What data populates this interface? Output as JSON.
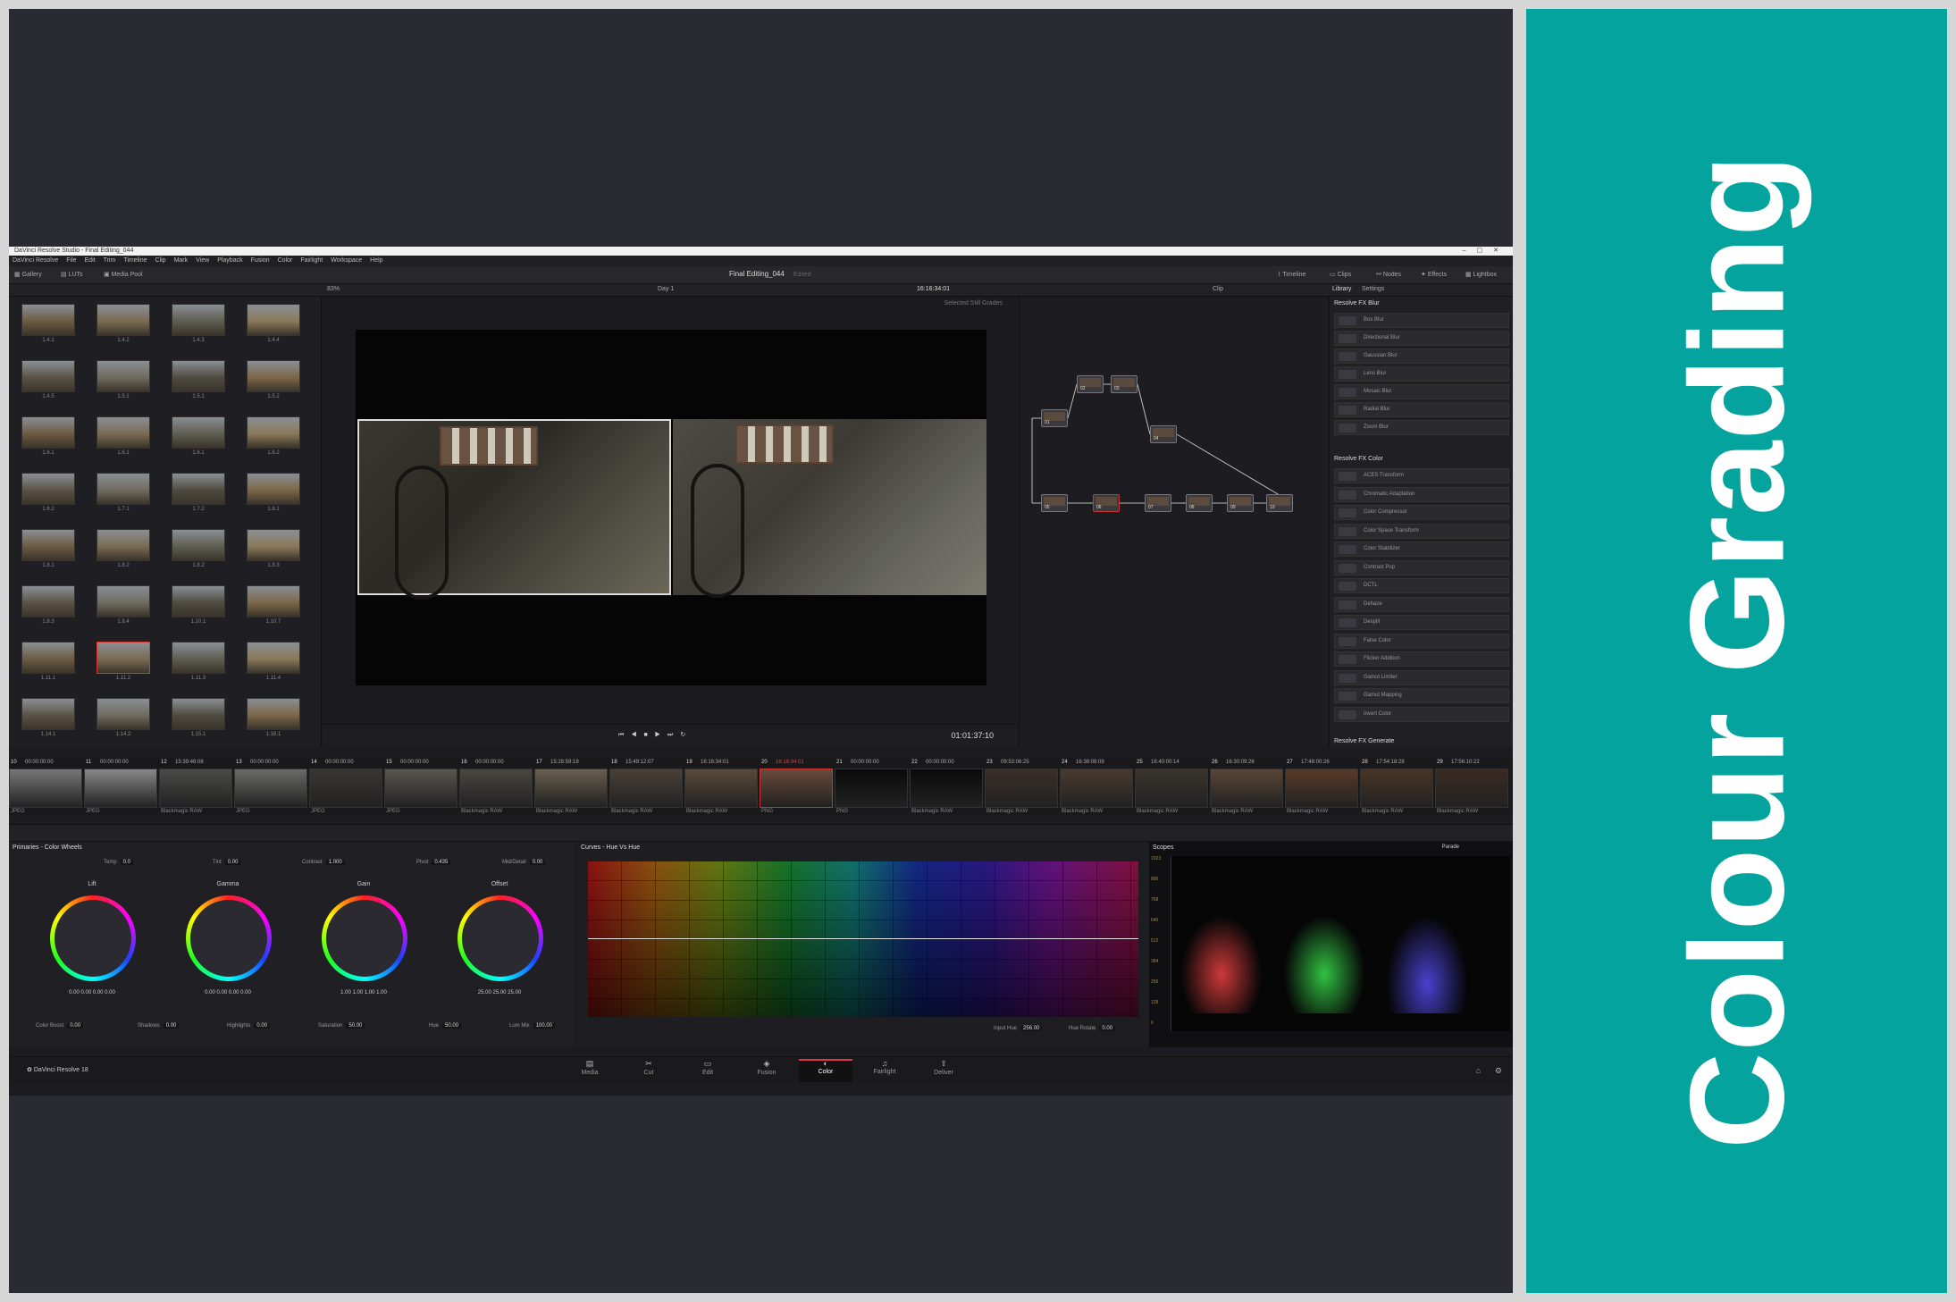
{
  "banner": {
    "text": "Colour Grading"
  },
  "window": {
    "title": "DaVinci Resolve Studio - Final Editing_044"
  },
  "menu": [
    "DaVinci Resolve",
    "File",
    "Edit",
    "Trim",
    "Timeline",
    "Clip",
    "Mark",
    "View",
    "Playback",
    "Fusion",
    "Color",
    "Fairlight",
    "Workspace",
    "Help"
  ],
  "toolbar": {
    "gallery": "Gallery",
    "luts": "LUTs",
    "media_pool": "Media Pool",
    "project": "Final Editing_044",
    "status": "Edited",
    "timeline": "Timeline",
    "clips": "Clips",
    "nodes": "Nodes",
    "effects": "Effects",
    "lightbox": "Lightbox"
  },
  "viewer": {
    "zoom": "83%",
    "timeline_name": "Day 1",
    "source_tc": "16:16:34:01",
    "selected": "Selected Still Grades",
    "timecode": "01:01:37:10"
  },
  "nodes_bar": {
    "mode": "Clip"
  },
  "library": {
    "tab1": "Library",
    "tab2": "Settings",
    "blur_head": "Resolve FX Blur",
    "blur": [
      "Box Blur",
      "Directional Blur",
      "Gaussian Blur",
      "Lens Blur",
      "Mosaic Blur",
      "Radial Blur",
      "Zoom Blur"
    ],
    "color_head": "Resolve FX Color",
    "color": [
      "ACES Transform",
      "Chromatic Adaptation",
      "Color Compressor",
      "Color Space Transform",
      "Color Stabilizer",
      "Contrast Pop",
      "DCTL",
      "Dehaze",
      "Despill",
      "False Color",
      "Flicker Addition",
      "Gamut Limiter",
      "Gamut Mapping",
      "Invert Color"
    ],
    "generate_head": "Resolve FX Generate"
  },
  "gallery": {
    "labels": [
      "1.4.1",
      "1.4.2",
      "1.4.3",
      "1.4.4",
      "1.4.5",
      "1.5.1",
      "1.5.1",
      "1.5.2",
      "1.6.1",
      "1.6.1",
      "1.6.1",
      "1.6.2",
      "1.6.2",
      "1.7.1",
      "1.7.2",
      "1.8.1",
      "1.8.1",
      "1.8.2",
      "1.8.2",
      "1.8.3",
      "1.8.3",
      "1.8.4",
      "1.10.1",
      "1.10.7",
      "1.11.1",
      "1.11.2",
      "1.11.3",
      "1.11.4",
      "1.14.1",
      "1.14.2",
      "1.15.1",
      "1.16.1"
    ]
  },
  "clips": {
    "timecodes": [
      "00:00:00:00",
      "00:00:00:00",
      "15:39:48:08",
      "00:00:00:00",
      "00:00:00:00",
      "00:00:00:00",
      "00:00:00:00",
      "15:28:59:19",
      "15:49:12:07",
      "16:16:34:01",
      "16:16:34:01",
      "00:00:00:00",
      "00:00:00:00",
      "09:53:06:25",
      "16:38:08:09",
      "16:40:00:14",
      "16:30:09:26",
      "17:48:00:26",
      "17:54:18:28",
      "17:56:10:22"
    ],
    "numbers": [
      "10",
      "11",
      "12",
      "13",
      "14",
      "15",
      "16",
      "17",
      "18",
      "19",
      "20",
      "21",
      "22",
      "23",
      "24",
      "25",
      "26",
      "27",
      "28",
      "29"
    ],
    "captions": [
      "JPEG",
      "JPEG",
      "Blackmagic RAW",
      "JPEG",
      "JPEG",
      "JPEG",
      "Blackmagic RAW",
      "Blackmagic RAW",
      "Blackmagic RAW",
      "Blackmagic RAW",
      "PNG",
      "PNG",
      "Blackmagic RAW",
      "Blackmagic RAW",
      "Blackmagic RAW",
      "Blackmagic RAW",
      "Blackmagic RAW",
      "Blackmagic RAW",
      "Blackmagic RAW",
      "Blackmagic RAW"
    ]
  },
  "primaries": {
    "title": "Primaries - Color Wheels",
    "temp_label": "Temp",
    "temp": "0.0",
    "tint_label": "Tint",
    "tint": "0.00",
    "contrast_label": "Contrast",
    "contrast": "1.000",
    "pivot_label": "Pivot",
    "pivot": "0.435",
    "mid_label": "Mid/Detail",
    "mid": "0.00",
    "wheels": [
      {
        "name": "Lift",
        "vals": "0.00  0.00  0.00  0.00"
      },
      {
        "name": "Gamma",
        "vals": "0.00  0.00  0.00  0.00"
      },
      {
        "name": "Gain",
        "vals": "1.00  1.00  1.00  1.00"
      },
      {
        "name": "Offset",
        "vals": "25.00  25.00  25.00"
      }
    ],
    "boost_label": "Color Boost",
    "boost": "0.00",
    "shadows_label": "Shadows",
    "shadows": "0.00",
    "highlights_label": "Highlights",
    "highlights": "0.00",
    "sat_label": "Saturation",
    "sat": "50.00",
    "hue_label": "Hue",
    "hue": "50.00",
    "lum_label": "Lum Mix",
    "lum": "100.00"
  },
  "curves": {
    "title": "Curves - Hue Vs Hue",
    "input_label": "Input Hue",
    "input": "256.00",
    "rot_label": "Hue Rotate",
    "rot": "0.00"
  },
  "scopes": {
    "title": "Scopes",
    "mode": "Parade",
    "ticks": [
      "1023",
      "896",
      "768",
      "640",
      "512",
      "384",
      "256",
      "128",
      "0"
    ]
  },
  "pages": [
    "Media",
    "Cut",
    "Edit",
    "Fusion",
    "Color",
    "Fairlight",
    "Deliver"
  ],
  "footer": {
    "app": "DaVinci Resolve 18"
  }
}
